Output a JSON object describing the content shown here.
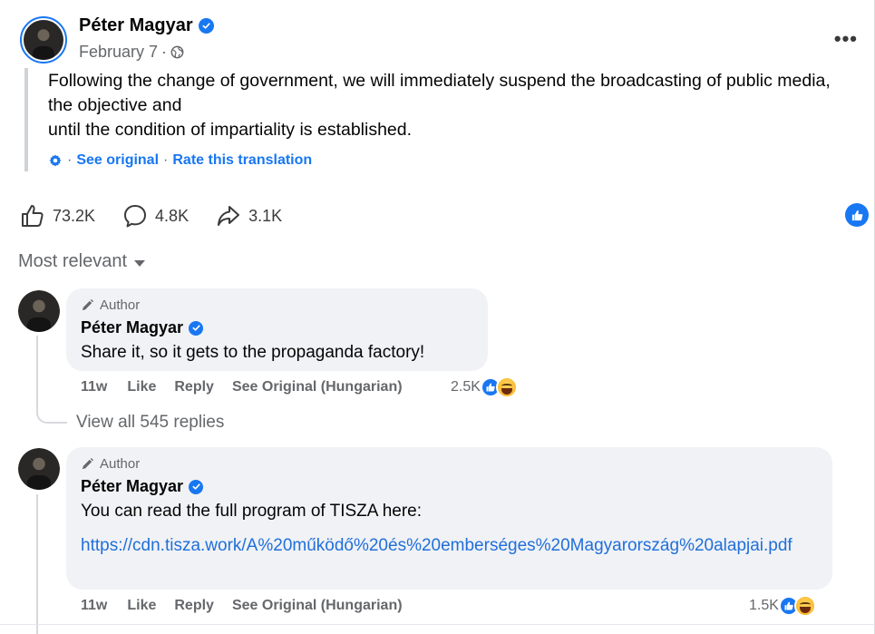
{
  "post": {
    "author": "Péter Magyar",
    "date": "February 7",
    "date_sep": "·",
    "text_lines": [
      "Following the change of government, we will immediately suspend the broadcasting of public media, the objective and",
      "until the condition of impartiality is established."
    ],
    "see_original": "See original",
    "rate_translation": "Rate this translation",
    "sep": "·",
    "more": "•••"
  },
  "actions": {
    "likes": "73.2K",
    "comments": "4.8K",
    "shares": "3.1K"
  },
  "sort_label": "Most relevant",
  "comments": [
    {
      "tag": "Author",
      "name": "Péter Magyar",
      "text": "Share it, so it gets to the propaganda factory!",
      "time": "11w",
      "like": "Like",
      "reply": "Reply",
      "see_original": "See Original (Hungarian)",
      "reaction_count": "2.5K"
    },
    {
      "tag": "Author",
      "name": "Péter Magyar",
      "text": "You can read the full program of TISZA here:",
      "link": "https://cdn.tisza.work/A%20működő%20és%20emberséges%20Magyarország%20alapjai.pdf",
      "time": "11w",
      "like": "Like",
      "reply": "Reply",
      "see_original": "See Original (Hungarian)",
      "reaction_count": "1.5K"
    }
  ],
  "view_replies": "View all 545 replies",
  "colors": {
    "accent": "#1877f2",
    "link": "#216fdb",
    "muted": "#65676b",
    "bubble": "#f0f2f5"
  },
  "icons": [
    "verified-badge-icon",
    "globe-icon",
    "gear-icon",
    "thumbs-up-icon",
    "comment-icon",
    "share-icon",
    "pencil-icon",
    "haha-reaction-icon",
    "caret-down-icon"
  ]
}
